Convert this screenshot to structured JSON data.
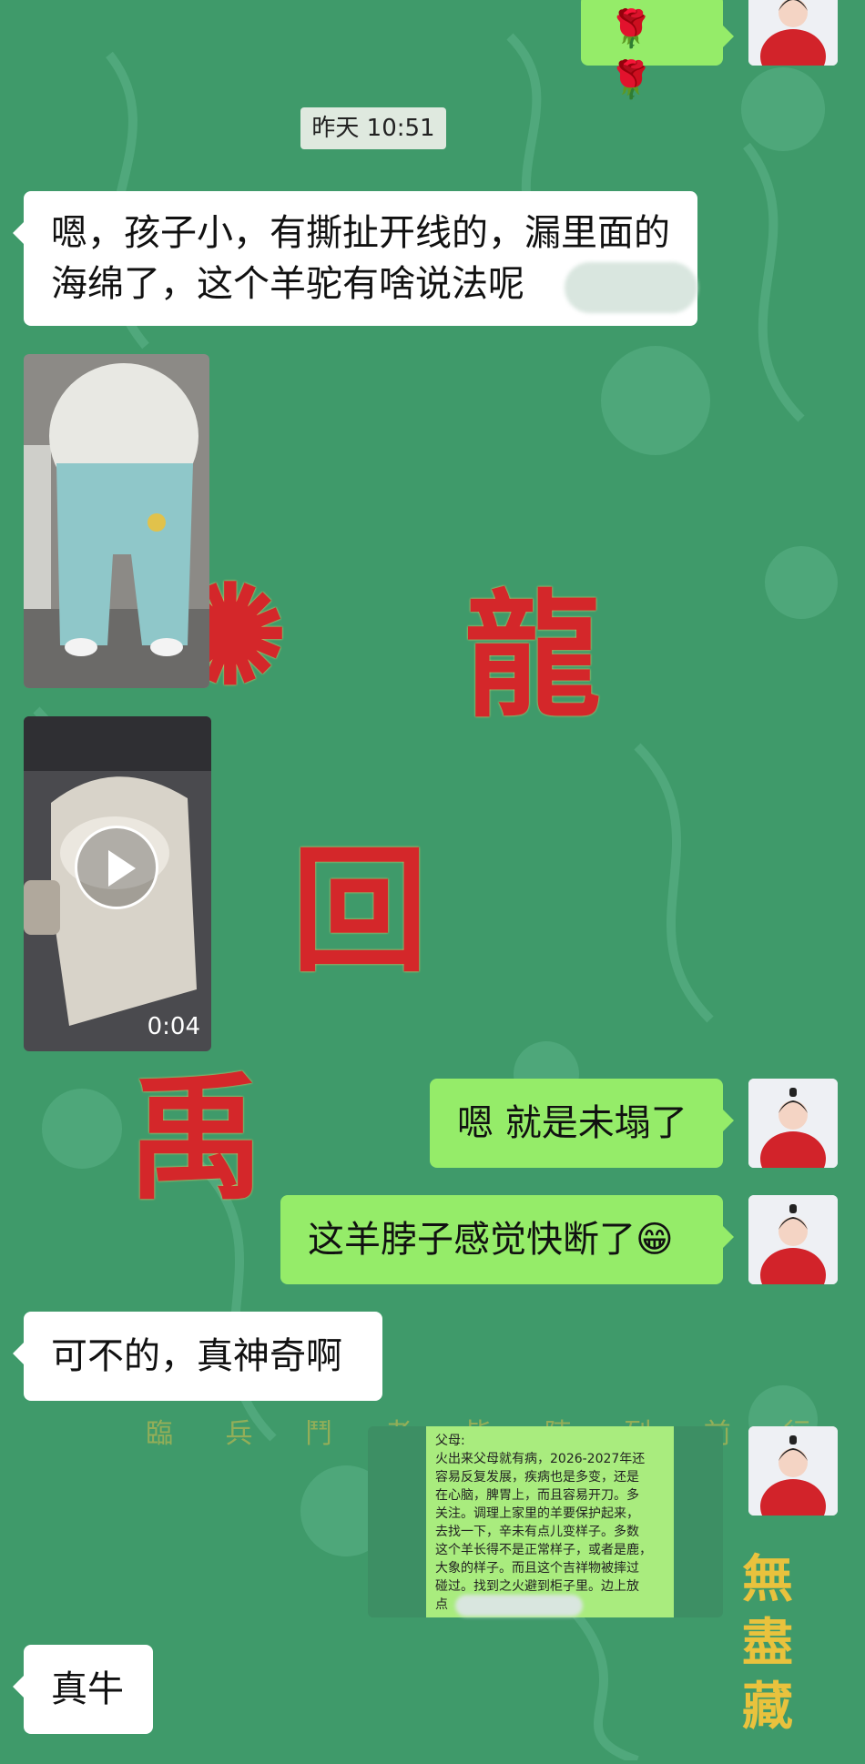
{
  "chat": {
    "timestamp": "昨天 10:51",
    "messages": [
      {
        "side": "right",
        "kind": "emoji",
        "emoji": "🌹 🌹"
      },
      {
        "side": "left",
        "kind": "text",
        "text": "嗯，孩子小，有撕扯开线的，漏里面的海绵了，这个羊驼有啥说法呢"
      },
      {
        "side": "left",
        "kind": "image",
        "description": "llama-doll-photo"
      },
      {
        "side": "left",
        "kind": "video",
        "duration": "0:04"
      },
      {
        "side": "right",
        "kind": "text",
        "text": "嗯 就是未塌了"
      },
      {
        "side": "right",
        "kind": "text",
        "text": "这羊脖子感觉快断了😁"
      },
      {
        "side": "left",
        "kind": "text",
        "text": "可不的，真神奇啊"
      },
      {
        "side": "right",
        "kind": "image",
        "description": "text-note-screenshot"
      },
      {
        "side": "left",
        "kind": "text",
        "text": "真牛"
      }
    ]
  },
  "note": {
    "title": "父母:",
    "lines": [
      "火出来父母就有病，2026-2027年还",
      "容易反复发展，疾病也是多变，还是",
      "在心脑，脾胃上，而且容易开刀。多",
      "关注。调理上家里的羊要保护起来，",
      "去找一下，辛未有点儿变样子。多数",
      "这个羊长得不是正常样子，或者是鹿，",
      "大象的样子。而且这个吉祥物被摔过",
      "碰过。找到之火避到柜子里。边上放",
      "点"
    ]
  },
  "background": {
    "banner_text": "臨 兵 鬥 者 皆 陣 列 前 行",
    "side_text": [
      "無",
      "盡",
      "藏"
    ]
  },
  "colors": {
    "background": "#3f9a6a",
    "bubble_green": "#95ec69",
    "bubble_white": "#ffffff",
    "seal_red": "#d4272a"
  }
}
